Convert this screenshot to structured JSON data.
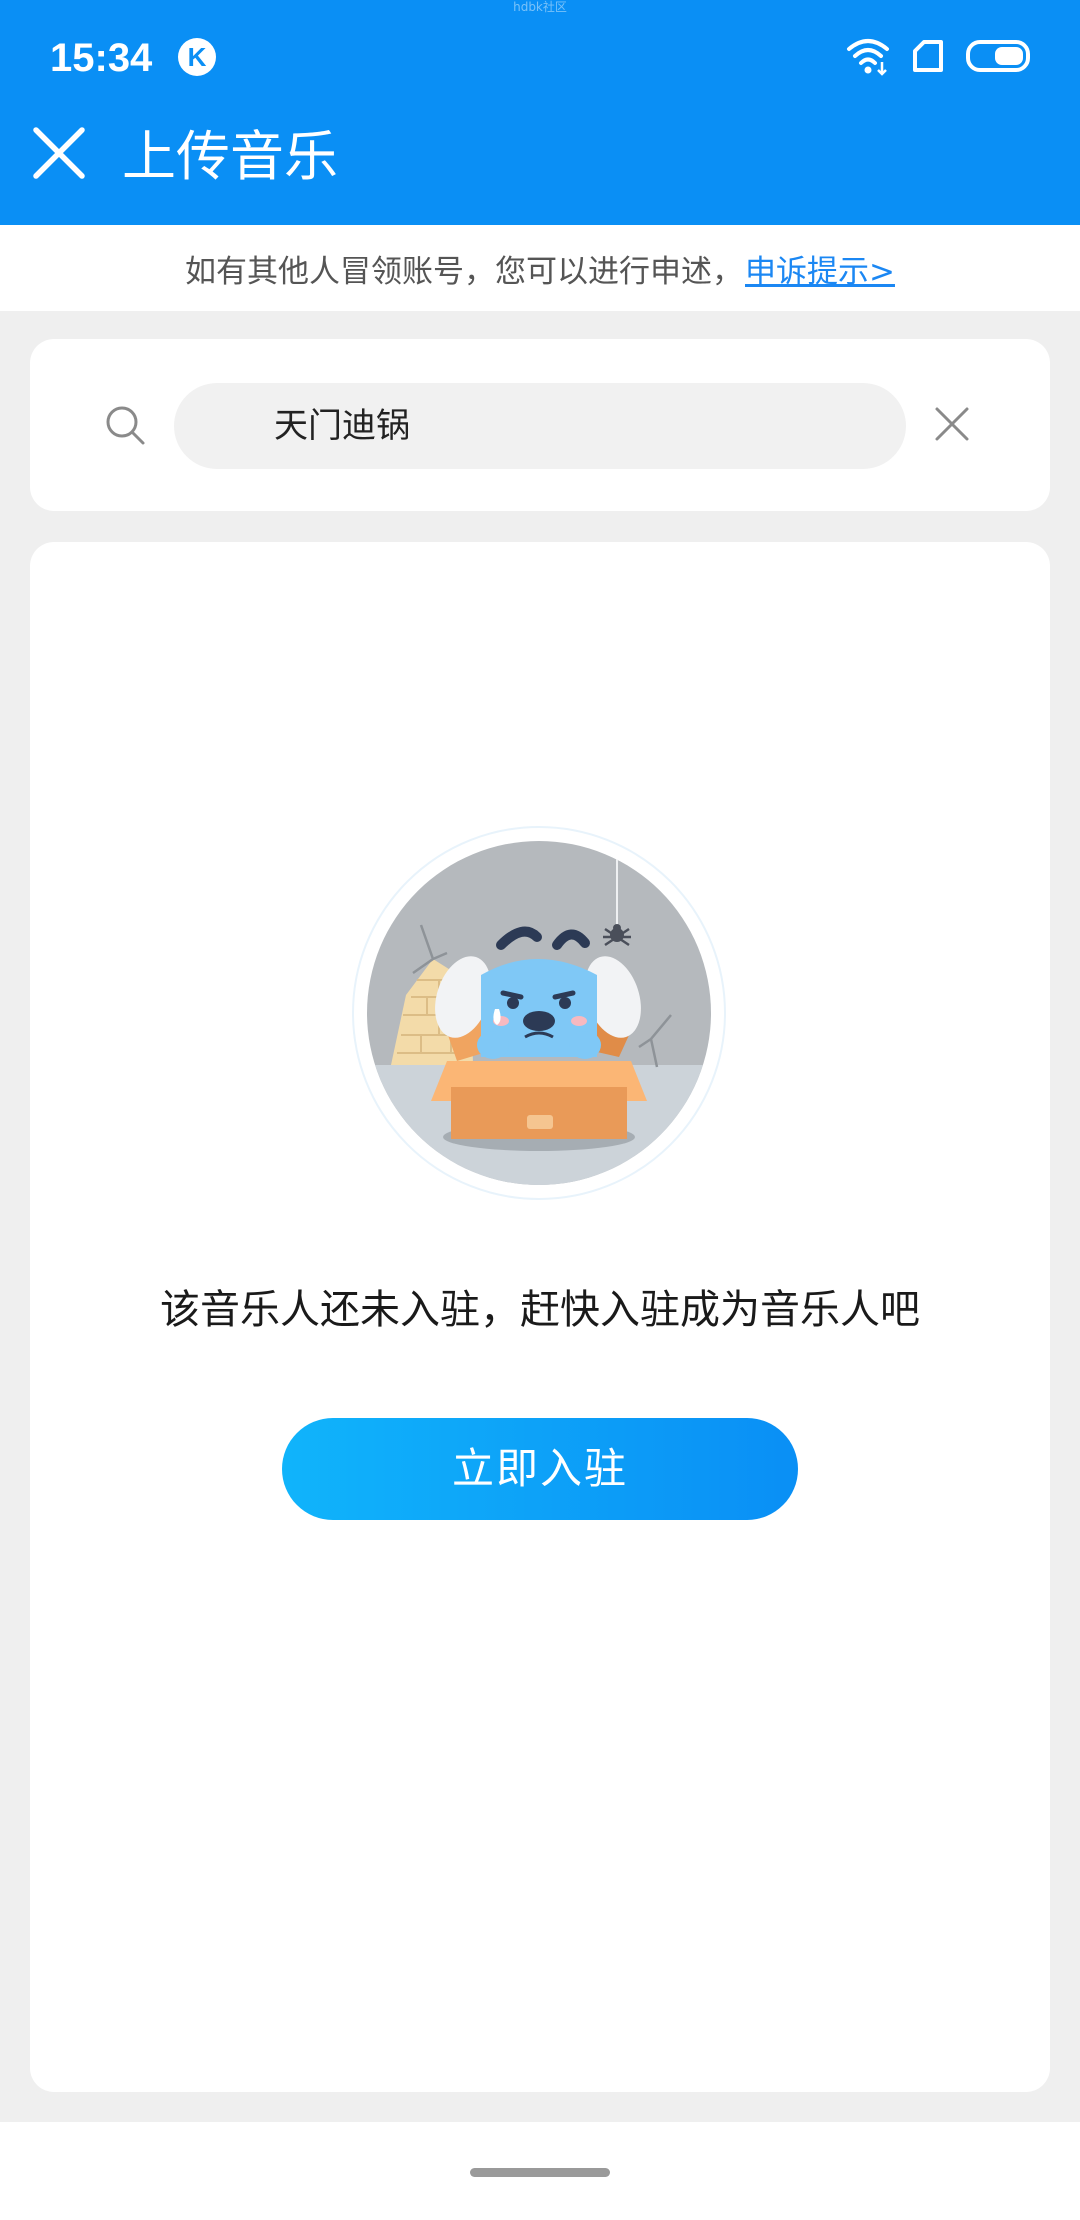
{
  "status_bar": {
    "time": "15:34",
    "app_badge": "K",
    "carrier_text": "hdbk社区",
    "icons": [
      "k-app-icon",
      "wifi-icon",
      "sim-icon",
      "battery-icon"
    ]
  },
  "header": {
    "title": "上传音乐",
    "close_icon": "close-icon",
    "background_color": "#0a8ff5"
  },
  "notice": {
    "text": "如有其他人冒领账号，您可以进行申述，",
    "link_text": "申诉提示>",
    "link_color": "#1b87f3"
  },
  "search": {
    "value": "天门迪锅",
    "search_icon": "search-icon",
    "clear_icon": "clear-icon"
  },
  "empty_state": {
    "illustration": "sad-dog-in-box-illustration",
    "message": "该音乐人还未入驻，赶快入驻成为音乐人吧",
    "button_label": "立即入驻",
    "button_colors": [
      "#10b4fb",
      "#0a8ff5"
    ]
  }
}
